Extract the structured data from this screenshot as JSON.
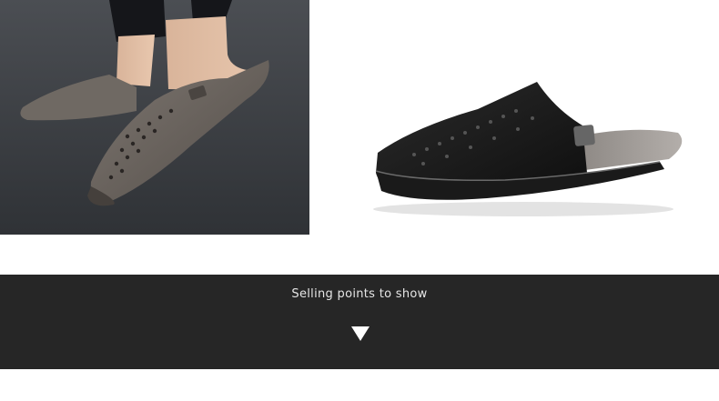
{
  "images": {
    "left": {
      "name": "photo-worn-slipper",
      "subject": "grey perforated leather slip-on mule worn on foot"
    },
    "right": {
      "name": "photo-product-slipper",
      "subject": "black perforated leather backless loafer, side view"
    }
  },
  "banner": {
    "text": "Selling points to show",
    "background": "#262626",
    "text_color": "#e6e6e6",
    "arrow_icon": "triangle-down-icon"
  }
}
